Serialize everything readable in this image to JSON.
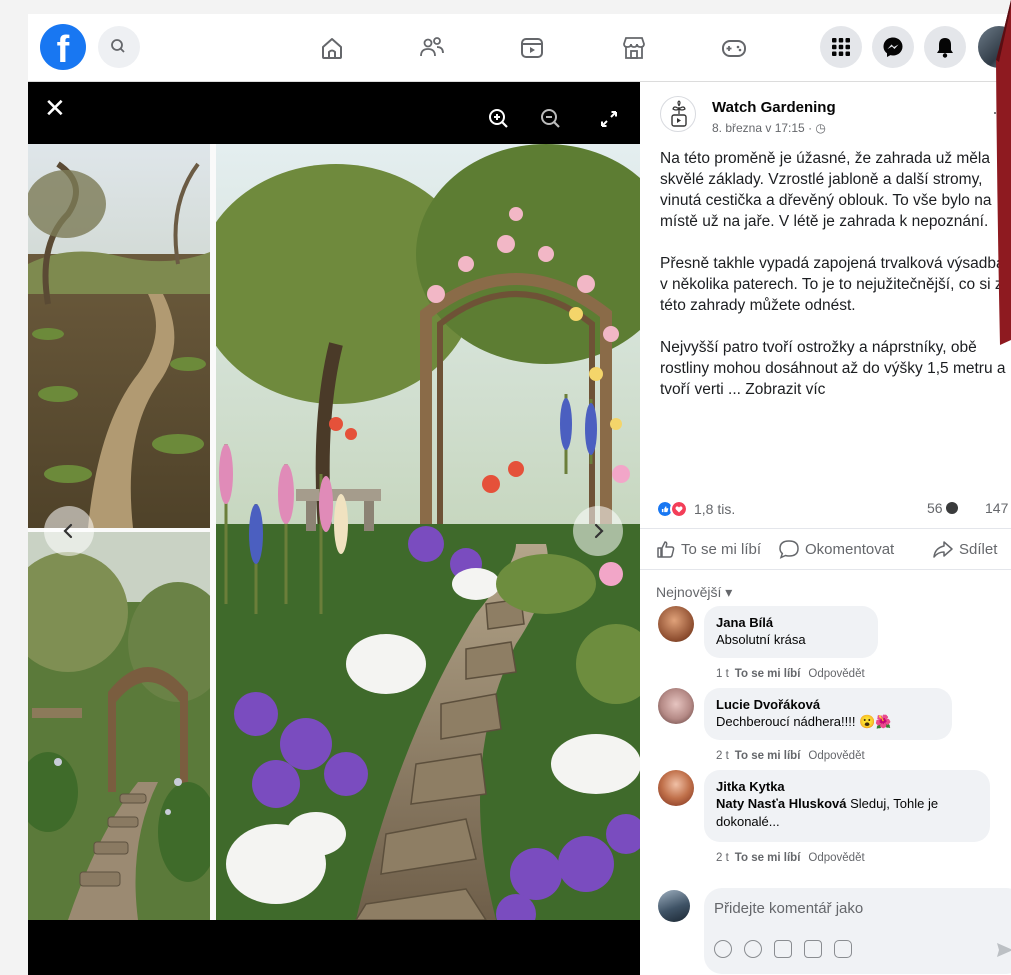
{
  "topbar": {
    "logo_letter": "f",
    "icons": [
      "search-icon",
      "home-icon",
      "friends-icon",
      "video-icon",
      "marketplace-icon",
      "gaming-icon",
      "menu-grid-icon",
      "messenger-icon",
      "notifications-icon"
    ]
  },
  "viewer": {
    "close_label": "✕",
    "tools": [
      "zoom-in-icon",
      "zoom-out-icon",
      "fullscreen-icon"
    ],
    "prev_label": "‹",
    "next_label": "›"
  },
  "post": {
    "author": "Watch Gardening",
    "date": "8. března v 17:15 · ",
    "paragraphs": [
      "Na této proměně je úžasné, že zahrada už měla skvělé základy. Vzrostlé jabloně a další stromy, vinutá cestička a dřevěný oblouk. To vše bylo na místě už na jaře. V létě je zahrada k nepoznání.",
      "Přesně takhle vypadá zapojená trvalková výsadba v několika paterech. To je to nejužitečnější, co si z této zahrady můžete odnést.",
      "Nejvyšší patro tvoří ostrožky a náprstníky, obě rostliny mohou dosáhnout až do výšky 1,5 metru a tvoří verti ... "
    ],
    "see_more": "Zobrazit víc",
    "reactions_count": "1,8 tis.",
    "comments_count": "56",
    "shares_count": "147",
    "actions": {
      "like": "To se mi líbí",
      "comment": "Okomentovat",
      "share": "Sdílet"
    },
    "sort_label": "Nejnovější ▾",
    "colors": {
      "like_blue": "#1877f2",
      "love_red": "#f33e58"
    }
  },
  "comments": [
    {
      "name": "Jana Bílá",
      "text": "Absolutní krása",
      "time": "1 t",
      "like": "To se mi líbí",
      "reply": "Odpovědět"
    },
    {
      "name": "Lucie Dvořáková",
      "text": "Dechberoucí nádhera!!!!",
      "emoji": "😮🌺",
      "time": "2 t",
      "like": "To se mi líbí",
      "reply": "Odpovědět"
    },
    {
      "name": "Jitka Kytka",
      "mention": "Naty Nasťa Hlusková",
      "text": " Sleduj, Tohle je dokonalé...",
      "time": "2 t",
      "like": "To se mi líbí",
      "reply": "Odpovědět"
    }
  ],
  "compose": {
    "placeholder": "Přidejte komentář jako"
  }
}
